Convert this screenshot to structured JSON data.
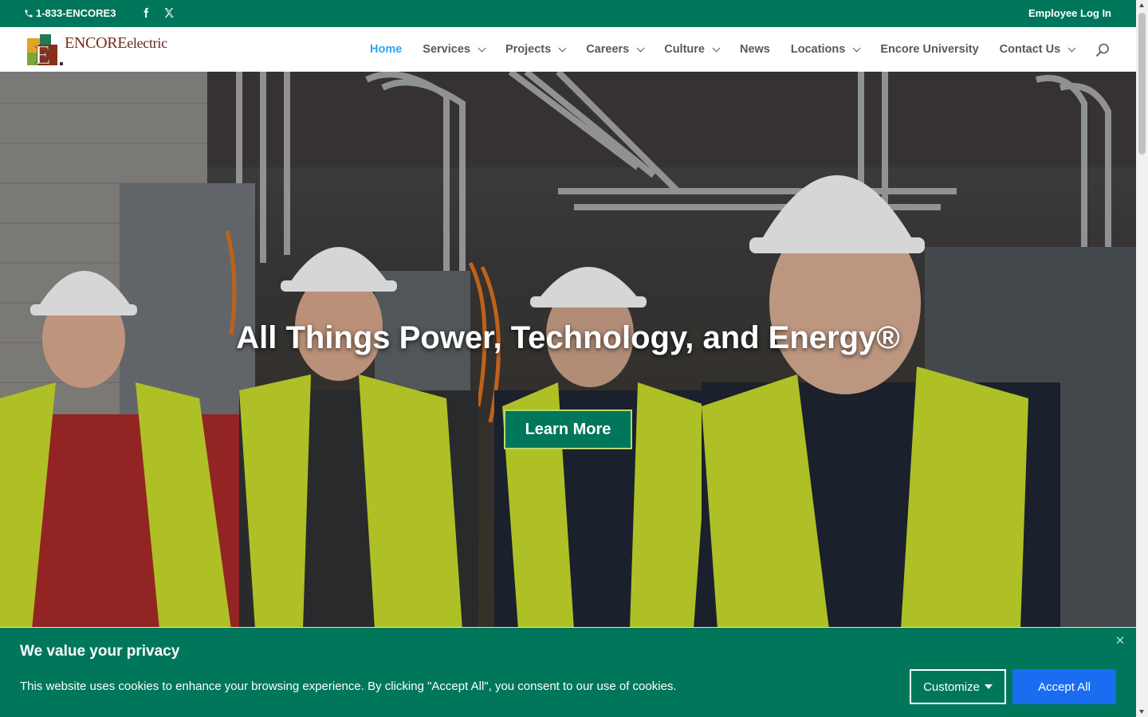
{
  "topbar": {
    "phone": "1-833-ENCORE3",
    "phone_icon": "phone-icon",
    "social": [
      "facebook-icon",
      "x-twitter-icon"
    ],
    "login": "Employee Log In",
    "bg_color": "#00775a"
  },
  "header": {
    "logo_text_main": "ENCORE",
    "logo_text_sub": "electric",
    "nav": [
      {
        "label": "Home",
        "active": true,
        "dropdown": false
      },
      {
        "label": "Services",
        "active": false,
        "dropdown": true
      },
      {
        "label": "Projects",
        "active": false,
        "dropdown": true
      },
      {
        "label": "Careers",
        "active": false,
        "dropdown": true
      },
      {
        "label": "Culture",
        "active": false,
        "dropdown": true
      },
      {
        "label": "News",
        "active": false,
        "dropdown": false
      },
      {
        "label": "Locations",
        "active": false,
        "dropdown": true
      },
      {
        "label": "Encore University",
        "active": false,
        "dropdown": false
      },
      {
        "label": "Contact Us",
        "active": false,
        "dropdown": true
      }
    ],
    "active_color": "#2ea3f2",
    "search_icon": "search-icon"
  },
  "hero": {
    "title": "All Things Power, Technology, and Energy®",
    "button": "Learn More",
    "button_color": "#00775a"
  },
  "cookie": {
    "title": "We value your privacy",
    "text": "This website uses cookies to enhance your browsing experience. By clicking \"Accept All\", you consent to our use of cookies.",
    "customize": "Customize",
    "accept": "Accept All",
    "close_icon": "close-icon",
    "accept_color": "#1a6cf0"
  }
}
